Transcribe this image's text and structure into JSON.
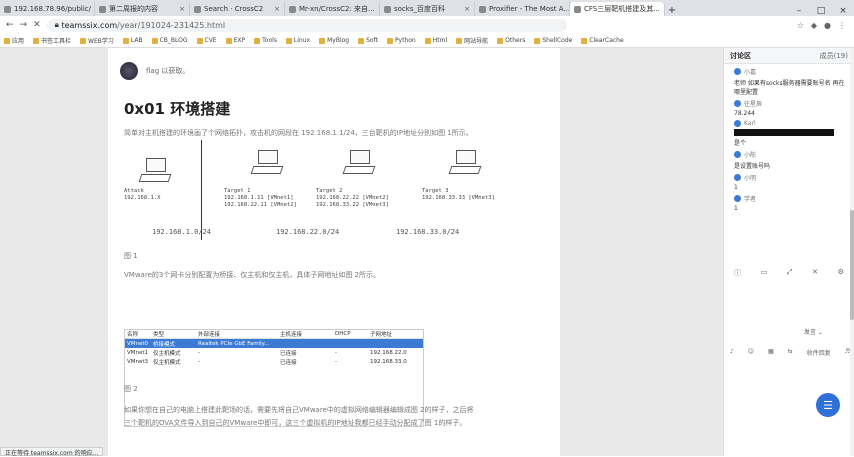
{
  "tabs": [
    {
      "label": "192.168.78.96/public/"
    },
    {
      "label": "第二周报的内容"
    },
    {
      "label": "Search · CrossC2"
    },
    {
      "label": "Mr-xn/CrossC2: 来自..."
    },
    {
      "label": "socks_百度百科"
    },
    {
      "label": "Proxifier - The Most A..."
    },
    {
      "label": "CFS三层靶机搭建及其..."
    }
  ],
  "address": {
    "host": "teamssix.com",
    "path": "/year/191024-231425.html"
  },
  "bookmarks": [
    "应用",
    "书签工具栏",
    "WEB学习",
    "LAB",
    "CB_BLOG",
    "CVE",
    "EXP",
    "Tools",
    "Linux",
    "MyBlog",
    "Soft",
    "Python",
    "Html",
    "网站导航",
    "Others",
    "ShellCode",
    "ClearCache"
  ],
  "article": {
    "top_line": "flag 以获取。",
    "section_title": "0x01 环境搭建",
    "intro": "简单对主机搭建的环境画了个网络拓扑，攻击机的网段在 192.168.1.1/24，三台靶机的IP地址分别如图 1所示。",
    "nodes": [
      {
        "label": "Attack\n192.168.1.X"
      },
      {
        "label": "Target 1\n192.168.1.11 [VMnet1]\n192.168.22.11 [VMnet2]"
      },
      {
        "label": "Target 2\n192.168.22.22 [VMnet2]\n192.168.33.22 [VMnet3]"
      },
      {
        "label": "Target 3\n192.168.33.33 [VMnet3]"
      }
    ],
    "subnets": [
      "192.168.1.0/24",
      "192.168.22.0/24",
      "192.168.33.0/24"
    ],
    "fig1_caption": "图 1",
    "vmware_intro": "VMware的3个网卡分别配置为桥接、仅主机和仅主机，具体子网地址如图 2所示。",
    "vm_table": {
      "headers": [
        "名称",
        "类型",
        "外部连接",
        "主机连接",
        "DHCP",
        "子网地址"
      ],
      "rows": [
        [
          "VMnet0",
          "桥接模式",
          "Realtek PCIe GbE Family...",
          "",
          "",
          ""
        ],
        [
          "VMnet1",
          "仅主机模式",
          "-",
          "已连接",
          "-",
          "192.168.22.0"
        ],
        [
          "VMnet3",
          "仅主机模式",
          "-",
          "已连接",
          "-",
          "192.168.33.0"
        ]
      ]
    },
    "fig2_caption": "图 2",
    "para2_line1": "如果你想在自己的电脑上搭建此靶场的话，需要先将自己VMware中的虚拟网络编辑器编辑成图 2的样子，之后将",
    "para2_line2": "三个靶机的OVA文件导入到自己的VMware中即可，这三个虚拟机的IP地址我都已经手动分配成了图 1的样子。"
  },
  "sidebar": {
    "title": "讨论区",
    "members": "成员(19)",
    "messages": [
      {
        "user": "小嘉",
        "text": "老师 如果有socks服务器需要账号名 再在哪里配置"
      },
      {
        "user": "往星辰",
        "text": "78.244"
      },
      {
        "user": "Karl",
        "text": ""
      },
      {
        "user": "",
        "text": "是个"
      },
      {
        "user": "小陈",
        "text": "是设置账号吗"
      },
      {
        "user": "小明",
        "text": "1"
      },
      {
        "user": "学者",
        "text": "1"
      }
    ],
    "lang": "发言",
    "bottom": [
      "♪",
      "☺",
      "▦",
      "⇆",
      "收件回复",
      "♬"
    ]
  },
  "status_text": "正在等待 teamssix.com 的响应..."
}
